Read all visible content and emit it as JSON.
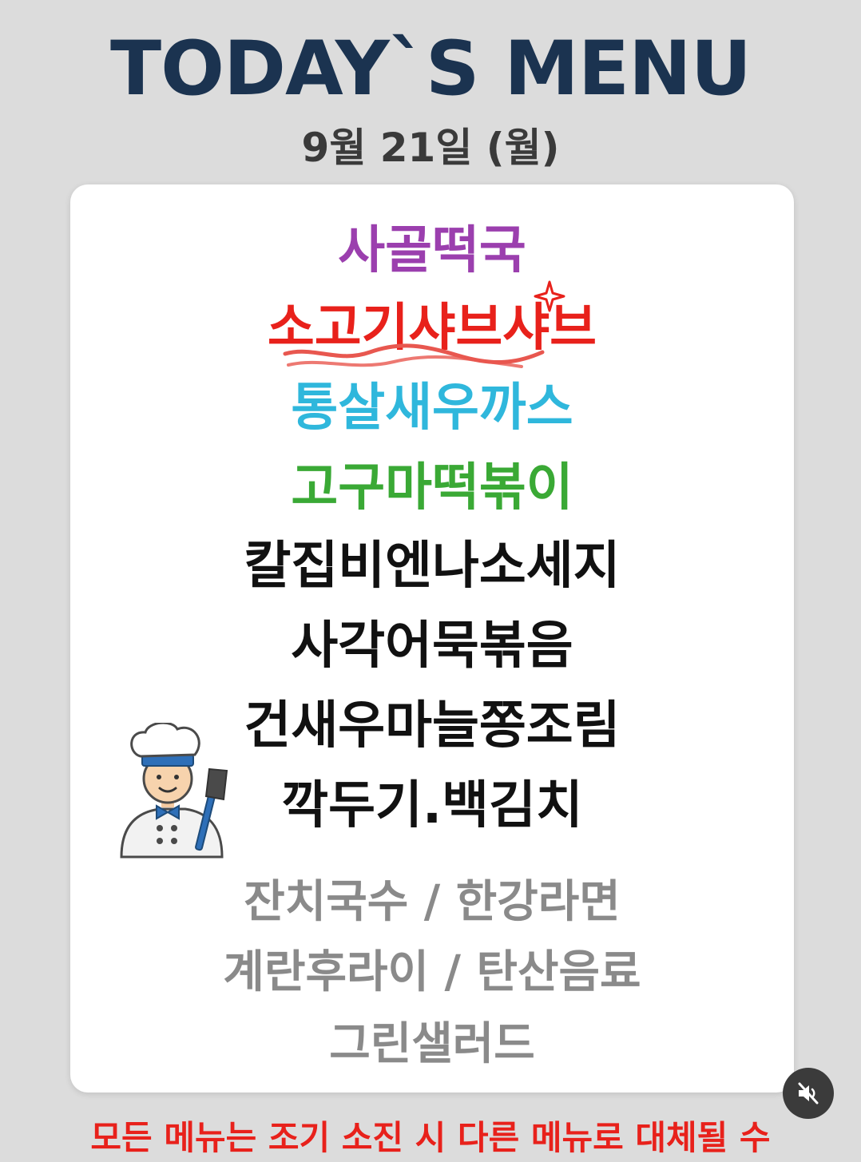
{
  "header": {
    "title": "TODAY`S MENU",
    "date": "9월 21일 (월)"
  },
  "menu": {
    "items": [
      {
        "label": "사골떡국",
        "color": "#9b3fae"
      },
      {
        "label": "소고기샤브샤브",
        "color": "#e8211b"
      },
      {
        "label": "통살새우까스",
        "color": "#2fb7dc"
      },
      {
        "label": "고구마떡볶이",
        "color": "#3aa935"
      },
      {
        "label": "칼집비엔나소세지",
        "color": "#111111"
      },
      {
        "label": "사각어묵볶음",
        "color": "#111111"
      },
      {
        "label": "건새우마늘쫑조림",
        "color": "#111111"
      },
      {
        "label": "깍두기.백김치",
        "color": "#111111"
      }
    ],
    "sides": [
      "잔치국수  / 한강라면",
      "계란후라이 / 탄산음료",
      "그린샐러드"
    ],
    "side_color": "#8a8a8a"
  },
  "footer": {
    "notice": "모든 메뉴는 조기 소진 시 다른 메뉴로 대체될 수"
  },
  "icons": {
    "chef": "chef-illustration-icon",
    "mute": "speaker-muted-icon"
  },
  "colors": {
    "title": "#1b3350",
    "date": "#3a3a3a",
    "notice": "#e8211b",
    "background": "#dcdcdc",
    "card": "#ffffff"
  }
}
